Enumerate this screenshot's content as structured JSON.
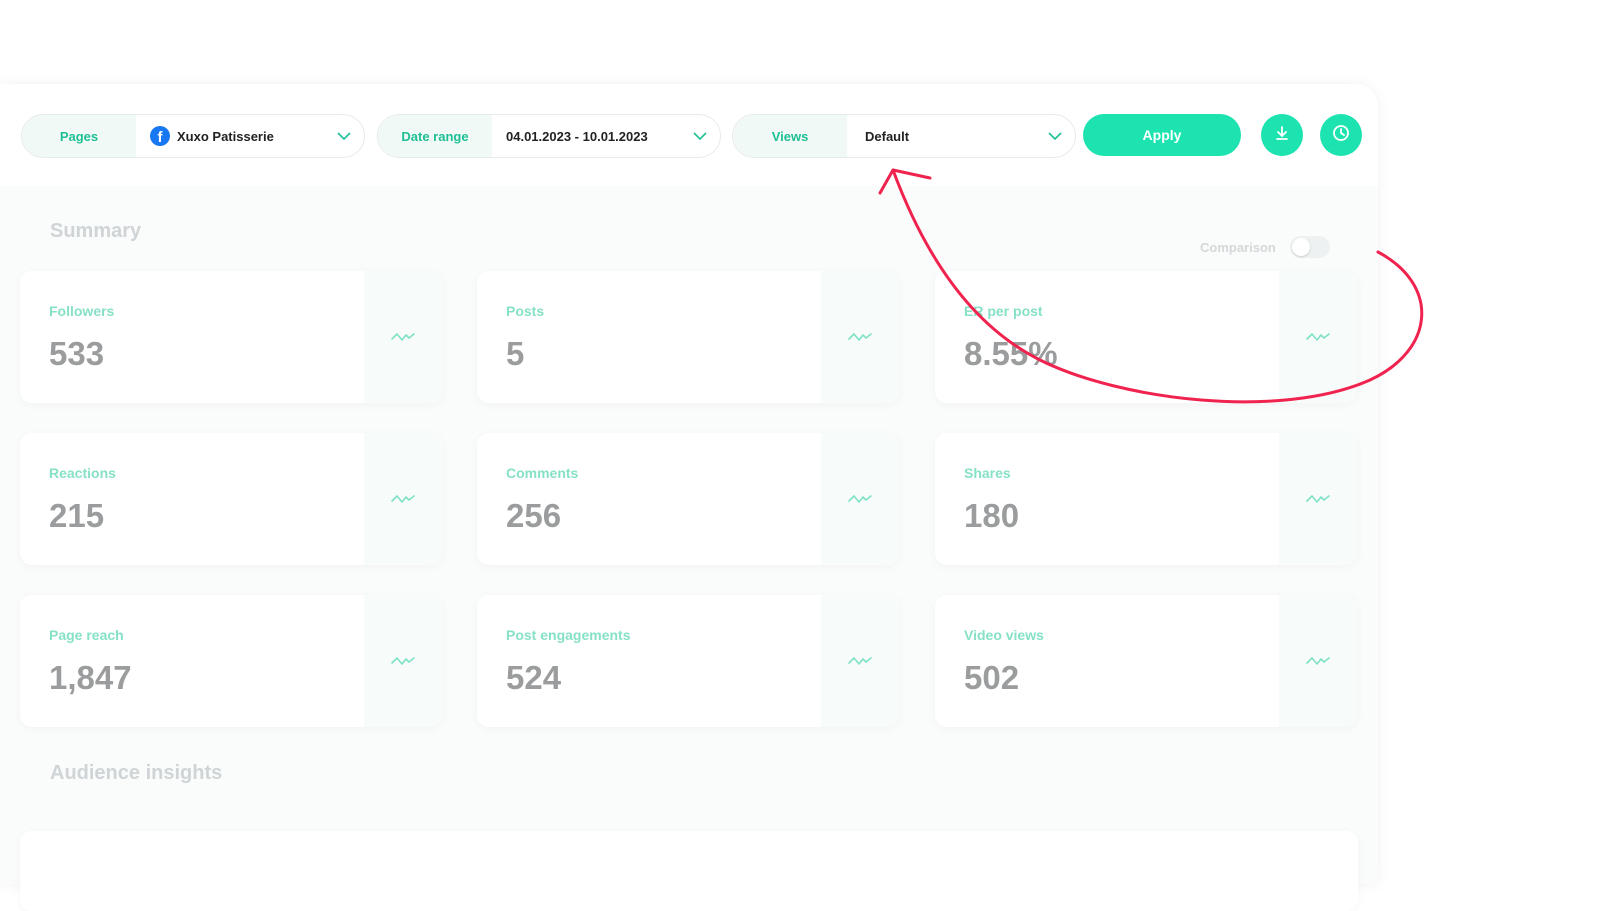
{
  "toolbar": {
    "pages_label": "Pages",
    "page_value": "Xuxo Patisserie",
    "date_label": "Date range",
    "date_value": "04.01.2023 - 10.01.2023",
    "views_label": "Views",
    "views_value": "Default",
    "apply_label": "Apply",
    "fb_glyph": "f"
  },
  "summary": {
    "title": "Summary",
    "comparison_label": "Comparison",
    "cards": [
      {
        "label": "Followers",
        "value": "533"
      },
      {
        "label": "Posts",
        "value": "5"
      },
      {
        "label": "ER per post",
        "value": "8.55%"
      },
      {
        "label": "Reactions",
        "value": "215"
      },
      {
        "label": "Comments",
        "value": "256"
      },
      {
        "label": "Shares",
        "value": "180"
      },
      {
        "label": "Page reach",
        "value": "1,847"
      },
      {
        "label": "Post engagements",
        "value": "524"
      },
      {
        "label": "Video views",
        "value": "502"
      }
    ]
  },
  "audience": {
    "title": "Audience insights"
  },
  "colors": {
    "accent": "#1de3b0",
    "annotation": "#f0234f",
    "label": "#86e1c7"
  },
  "icons": [
    "facebook-icon",
    "chevron-down-icon",
    "download-icon",
    "clock-icon",
    "trend-icon"
  ]
}
